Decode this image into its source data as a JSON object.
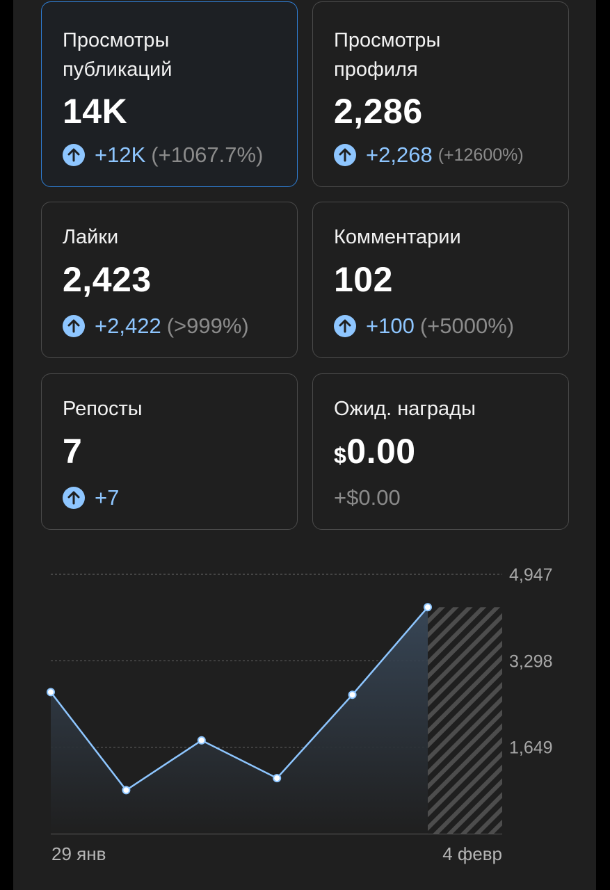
{
  "colors": {
    "background": "#1f1f1f",
    "card_border": "#4a4a4a",
    "selected_border": "#2f7fd6",
    "accent": "#8ec6ff",
    "muted": "#8b8b8b",
    "line": "#8ec6ff"
  },
  "cards": [
    {
      "title": "Просмотры\nпубликаций",
      "value": "14K",
      "delta": "+12K",
      "pct": "(+1067.7%)",
      "selected": true,
      "icon": "arrow-up-circle-icon"
    },
    {
      "title": "Просмотры\nпрофиля",
      "value": "2,286",
      "delta": "+2,268",
      "pct": "(+12600%)",
      "selected": false,
      "icon": "arrow-up-circle-icon"
    },
    {
      "title": "Лайки",
      "value": "2,423",
      "delta": "+2,422",
      "pct": "(>999%)",
      "selected": false,
      "icon": "arrow-up-circle-icon"
    },
    {
      "title": "Комментарии",
      "value": "102",
      "delta": "+100",
      "pct": "(+5000%)",
      "selected": false,
      "icon": "arrow-up-circle-icon"
    },
    {
      "title": "Репосты",
      "value": "7",
      "delta": "+7",
      "pct": "",
      "selected": false,
      "icon": "arrow-up-circle-icon"
    },
    {
      "title": "Ожид. награды",
      "currency": "$",
      "value": "0.00",
      "delta": "+$0.00",
      "pct": "",
      "selected": false,
      "icon": ""
    }
  ],
  "chart_data": {
    "type": "area",
    "x_labels": [
      "29 янв",
      "4 февр"
    ],
    "y_ticks": [
      "4,947",
      "3,298",
      "1,649"
    ],
    "y_tick_values": [
      4947,
      3298,
      1649
    ],
    "ylim": [
      0,
      4947
    ],
    "values": [
      2700,
      830,
      1780,
      1060,
      2650,
      4320
    ],
    "points": 6,
    "hatched_future_segment": true,
    "grid": "dashed horizontal",
    "y_axis_side": "right"
  }
}
